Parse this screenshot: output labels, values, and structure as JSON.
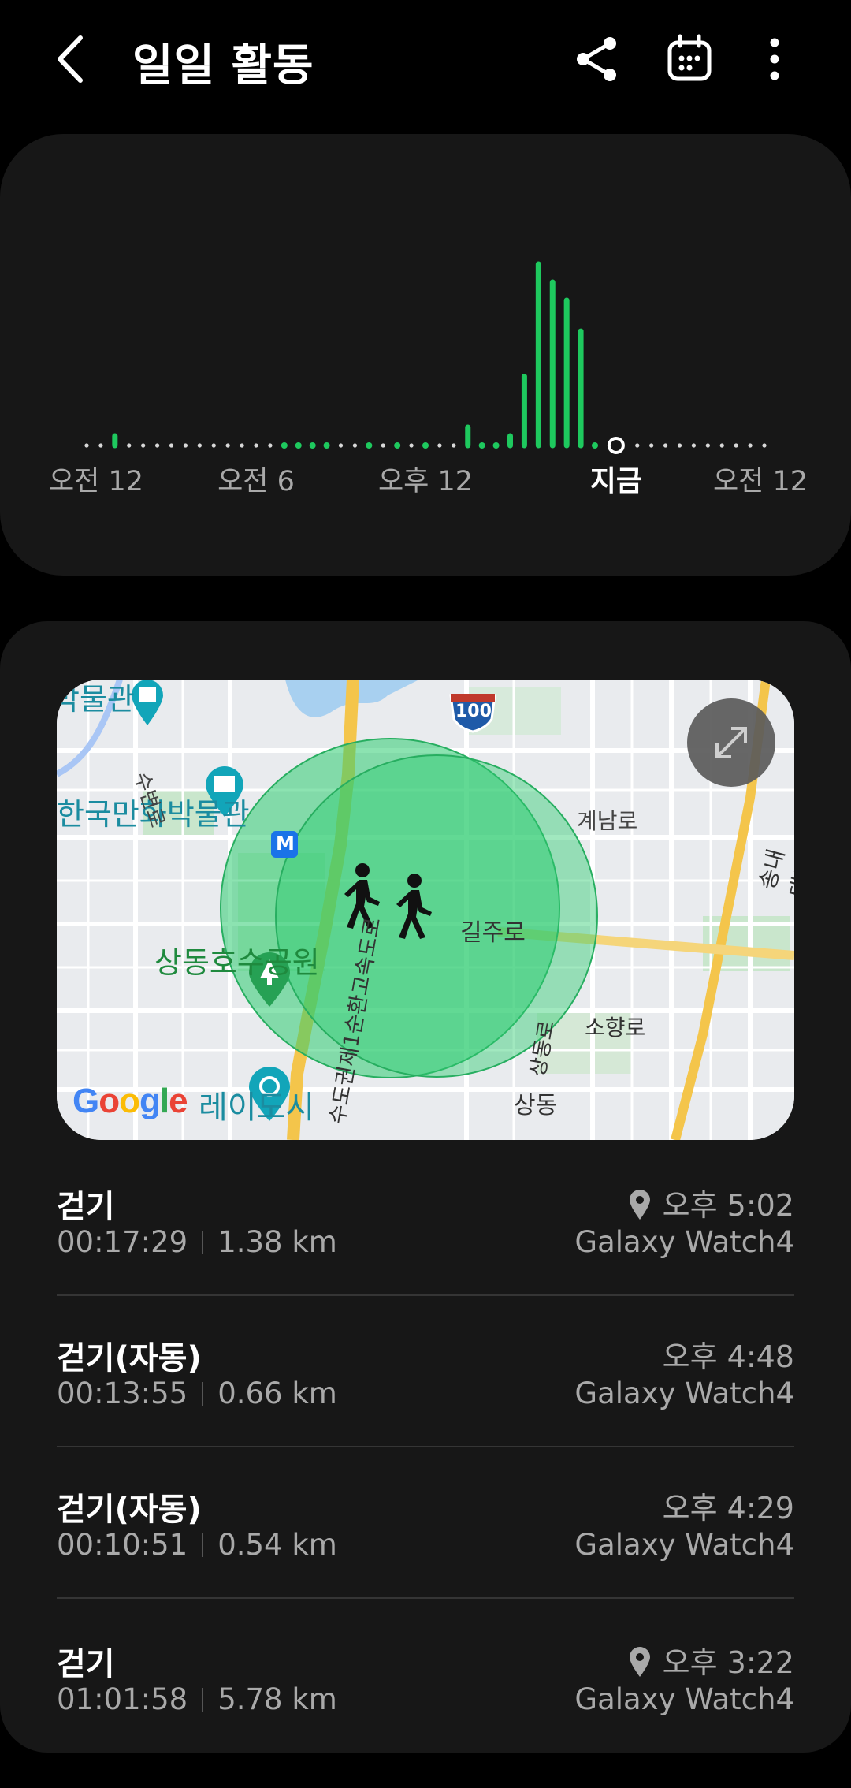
{
  "header": {
    "title": "일일 활동",
    "back_icon": "chevron-left-icon",
    "share_icon": "share-icon",
    "calendar_icon": "calendar-icon",
    "more_icon": "more-vert-icon"
  },
  "chart_data": {
    "type": "bar",
    "x_ticks": [
      "오전 12",
      "오전 6",
      "오후 12",
      "지금",
      "오전 12"
    ],
    "current_marker": "지금",
    "bars": [
      {
        "hour": 1.0,
        "value": 0.02
      },
      {
        "hour": 13.5,
        "value": 0.1
      },
      {
        "hour": 15.0,
        "value": 0.03
      },
      {
        "hour": 15.5,
        "value": 0.38
      },
      {
        "hour": 16.0,
        "value": 1.0
      },
      {
        "hour": 16.5,
        "value": 0.9
      },
      {
        "hour": 17.0,
        "value": 0.8
      },
      {
        "hour": 17.5,
        "value": 0.63
      }
    ],
    "active_dots_hours": [
      1.0,
      7.0,
      7.5,
      8.0,
      8.5,
      10.0,
      11.0,
      12.0,
      14.0,
      14.5,
      15.0,
      18.0
    ],
    "now_hour": 18.75,
    "colors": {
      "bar": "#1ec95e",
      "dot": "#d8d8d8",
      "grid_text": "#a9a9a9"
    }
  },
  "map": {
    "labels": {
      "museum_top": "박물관",
      "museum": "한국만화박물관",
      "park": "상동호수공원",
      "street_subyeon": "수변로",
      "street_gyenam": "계남로",
      "street_gil": "길주로",
      "street_sohyang": "소향로",
      "street_songnae": "송내대로",
      "street_sangdong_ro": "상동로",
      "area_sangdong": "상동",
      "area_city": "레이도시",
      "highway": "수도권제1순환고속도로",
      "route_badge": "100",
      "subway": "M",
      "attribution": "Google"
    },
    "expand_icon": "expand-icon",
    "walk_icon": "walking-person-icon",
    "colors": {
      "circle": "#2ecc71",
      "road_major": "#f5c842"
    }
  },
  "activities": [
    {
      "title": "걷기",
      "duration": "00:17:29",
      "distance": "1.38 km",
      "time": "오후 5:02",
      "device": "Galaxy Watch4",
      "has_location": true
    },
    {
      "title": "걷기(자동)",
      "duration": "00:13:55",
      "distance": "0.66 km",
      "time": "오후 4:48",
      "device": "Galaxy Watch4",
      "has_location": false
    },
    {
      "title": "걷기(자동)",
      "duration": "00:10:51",
      "distance": "0.54 km",
      "time": "오후 4:29",
      "device": "Galaxy Watch4",
      "has_location": false
    },
    {
      "title": "걷기",
      "duration": "01:01:58",
      "distance": "5.78 km",
      "time": "오후 3:22",
      "device": "Galaxy Watch4",
      "has_location": true
    }
  ]
}
